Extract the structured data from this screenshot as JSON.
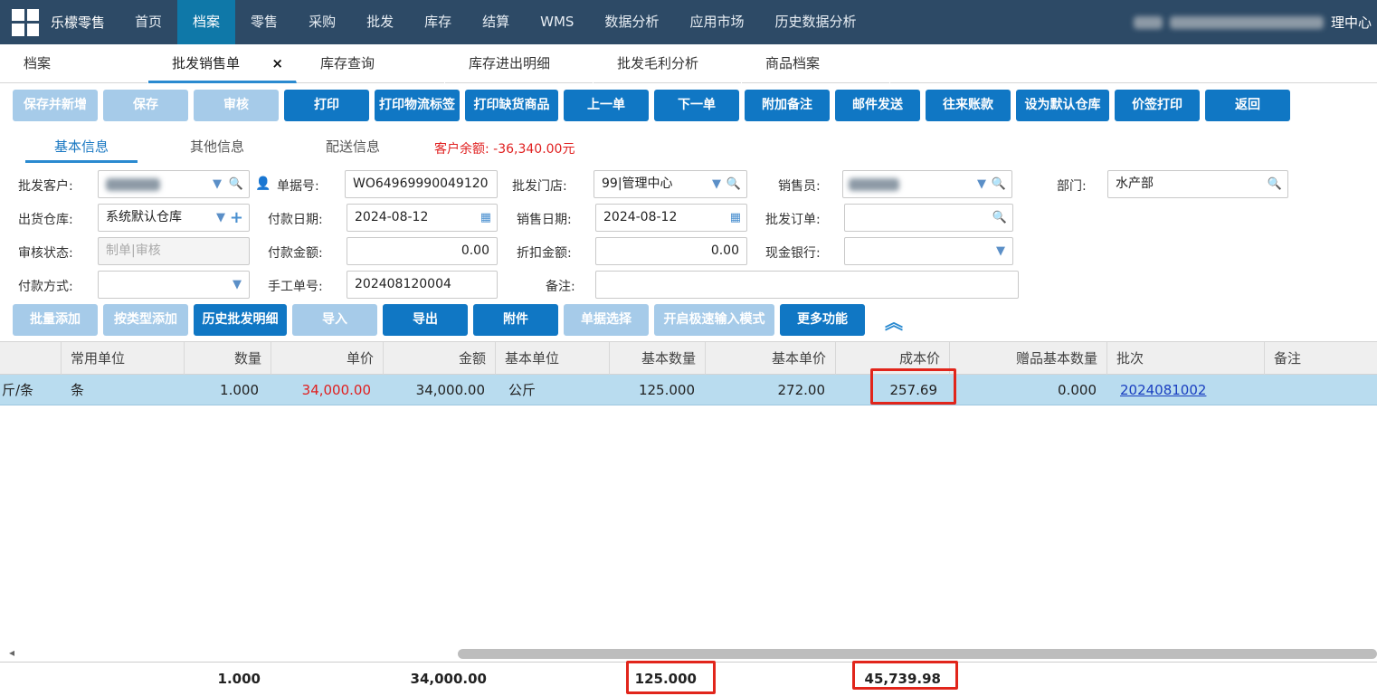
{
  "topnav": {
    "brand": "乐檬零售",
    "items": [
      "首页",
      "档案",
      "零售",
      "采购",
      "批发",
      "库存",
      "结算",
      "WMS",
      "数据分析",
      "应用市场",
      "历史数据分析"
    ],
    "active_index": 1,
    "right_label": "理中心"
  },
  "tabs": [
    {
      "label": "档案"
    },
    {
      "label": "批发销售单",
      "close": "×"
    },
    {
      "label": "库存查询"
    },
    {
      "label": "库存进出明细"
    },
    {
      "label": "批发毛利分析"
    },
    {
      "label": "商品档案"
    }
  ],
  "toolbar": [
    "保存并新增",
    "保存",
    "审核",
    "打印",
    "打印物流标签",
    "打印缺货商品",
    "上一单",
    "下一单",
    "附加备注",
    "邮件发送",
    "往来账款",
    "设为默认仓库",
    "价签打印",
    "返回"
  ],
  "subtabs": [
    "基本信息",
    "其他信息",
    "配送信息"
  ],
  "balance": "客户余额: -36,340.00元",
  "form": {
    "customer_label": "批发客户:",
    "doc_no_label": "单据号:",
    "doc_no": "WO64969990049120",
    "store_label": "批发门店:",
    "store": "99|管理中心",
    "salesman_label": "销售员:",
    "dept_label": "部门:",
    "dept": "水产部",
    "warehouse_label": "出货仓库:",
    "warehouse": "系统默认仓库",
    "pay_date_label": "付款日期:",
    "pay_date": "2024-08-12",
    "sale_date_label": "销售日期:",
    "sale_date": "2024-08-12",
    "order_label": "批发订单:",
    "audit_label": "审核状态:",
    "audit": "制单|审核",
    "pay_amount_label": "付款金额:",
    "pay_amount": "0.00",
    "discount_label": "折扣金额:",
    "discount": "0.00",
    "bank_label": "现金银行:",
    "pay_method_label": "付款方式:",
    "manual_no_label": "手工单号:",
    "manual_no": "202408120004",
    "remark_label": "备注:"
  },
  "actions": [
    "批量添加",
    "按类型添加",
    "历史批发明细",
    "导入",
    "导出",
    "附件",
    "单据选择",
    "开启极速输入模式",
    "更多功能"
  ],
  "collapse_icon": "︽",
  "table": {
    "headers": [
      "常用单位",
      "数量",
      "单价",
      "金额",
      "基本单位",
      "基本数量",
      "基本单价",
      "成本价",
      "赠品基本数量",
      "批次",
      "备注"
    ],
    "row": {
      "spec": "斤/条",
      "unit": "条",
      "qty": "1.000",
      "price": "34,000.00",
      "amount": "34,000.00",
      "base_unit": "公斤",
      "base_qty": "125.000",
      "base_price": "272.00",
      "cost": "257.69",
      "gift_qty": "0.000",
      "batch": "2024081002"
    }
  },
  "totals": {
    "qty": "1.000",
    "amount": "34,000.00",
    "base_qty": "125.000",
    "cost_total": "45,739.98"
  },
  "colors": {
    "nav_bg": "#2d4a66",
    "primary": "#1077c4",
    "highlight": "#e1251b"
  }
}
